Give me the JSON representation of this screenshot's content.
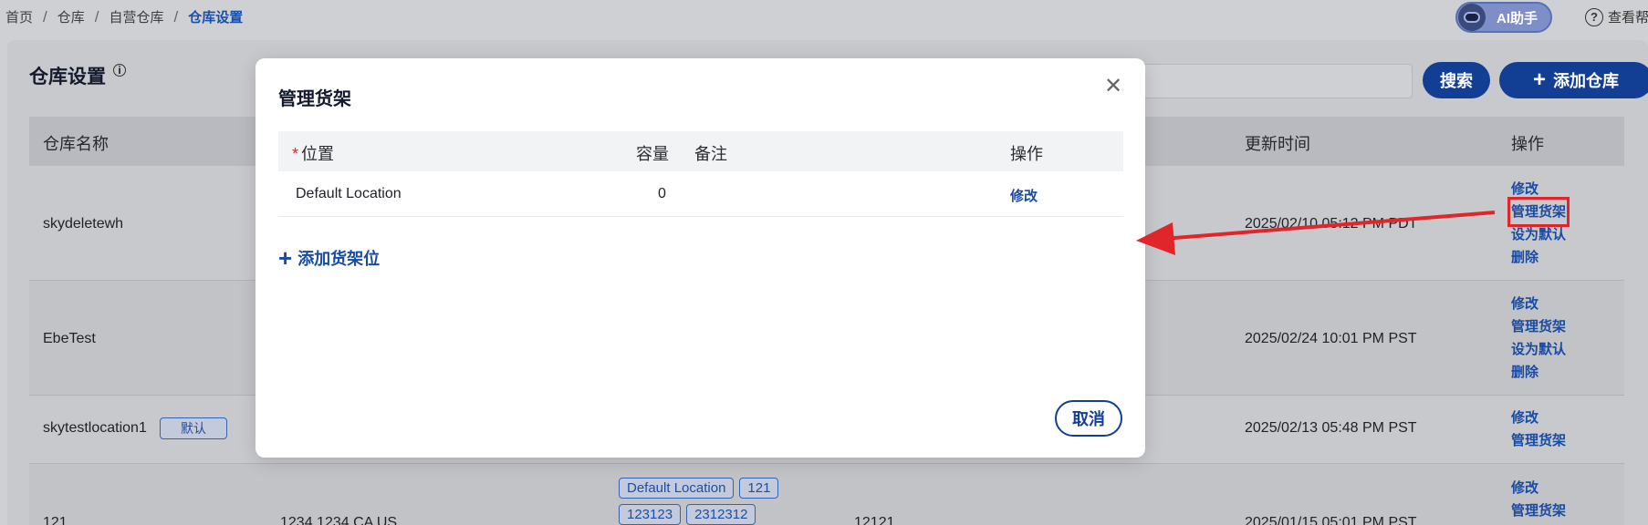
{
  "breadcrumb": [
    "首页",
    "仓库",
    "自营仓库",
    "仓库设置"
  ],
  "topbar": {
    "ai_label": "AI助手",
    "help_label": "查看帮"
  },
  "page": {
    "title": "仓库设置",
    "search_button": "搜索",
    "add_button": "添加仓库"
  },
  "table": {
    "headers": {
      "name": "仓库名称",
      "updated": "更新时间",
      "ops": "操作"
    },
    "rows": [
      {
        "name": "skydeletewh",
        "badge": "",
        "updated": "2025/02/10 05:12 PM PDT",
        "ops": [
          "修改",
          "管理货架",
          "设为默认",
          "删除"
        ]
      },
      {
        "name": "EbeTest",
        "badge": "",
        "updated": "2025/02/24 10:01 PM PST",
        "ops": [
          "修改",
          "管理货架",
          "设为默认",
          "删除"
        ]
      },
      {
        "name": "skytestlocation1",
        "badge": "默认",
        "updated": "2025/02/13 05:48 PM PST",
        "ops": [
          "修改",
          "管理货架"
        ]
      },
      {
        "name": "121",
        "address": "1234 1234 CA US",
        "tags": [
          "Default Location",
          "121",
          "123123",
          "2312312"
        ],
        "code": "12121",
        "updated": "2025/01/15 05:01 PM PST",
        "ops": [
          "修改",
          "管理货架"
        ]
      }
    ]
  },
  "modal": {
    "title": "管理货架",
    "headers": {
      "required_mark": "*",
      "location": "位置",
      "capacity": "容量",
      "note": "备注",
      "ops": "操作"
    },
    "row": {
      "location": "Default Location",
      "capacity": "0",
      "note": "",
      "edit": "修改"
    },
    "add_label": "添加货架位",
    "cancel_label": "取消"
  },
  "colors": {
    "primary": "#123e94",
    "link": "#1a4ba3",
    "highlight": "#e0262b"
  }
}
